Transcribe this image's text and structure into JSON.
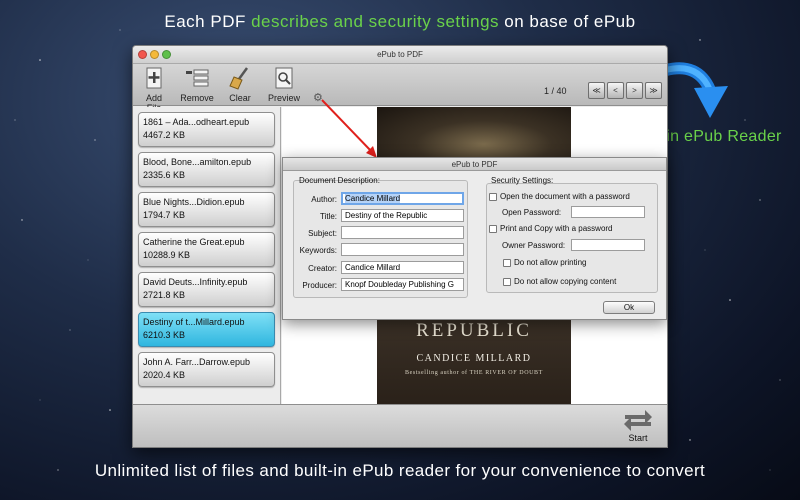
{
  "promo": {
    "headline_part1": "Each PDF ",
    "headline_highlight": "describes and security settings",
    "headline_part2": " on base of ePub",
    "reader_caption": "Built-in ePub Reader",
    "footer": "Unlimited list of files and built-in ePub reader for your convenience  to convert",
    "highlight_color": "#6ad24a"
  },
  "window": {
    "title": "ePub to PDF",
    "toolbar": {
      "add_file": "Add File",
      "remove": "Remove",
      "clear": "Clear",
      "preview": "Preview"
    },
    "page_indicator": "1 / 40",
    "nav": [
      "≪",
      "<",
      ">",
      "≫"
    ],
    "files": [
      {
        "name": "1861 – Ada...odheart.epub",
        "size": "4467.2 KB",
        "selected": false
      },
      {
        "name": "Blood, Bone...amilton.epub",
        "size": "2335.6 KB",
        "selected": false
      },
      {
        "name": "Blue Nights...Didion.epub",
        "size": "1794.7 KB",
        "selected": false
      },
      {
        "name": "Catherine the Great.epub",
        "size": "10288.9 KB",
        "selected": false
      },
      {
        "name": "David Deuts...Infinity.epub",
        "size": "2721.8 KB",
        "selected": false
      },
      {
        "name": "Destiny of t...Millard.epub",
        "size": "6210.3 KB",
        "selected": true
      },
      {
        "name": "John A. Farr...Darrow.epub",
        "size": "2020.4 KB",
        "selected": false
      }
    ],
    "preview": {
      "book_title": "REPUBLIC",
      "book_author": "CANDICE MILLARD",
      "book_tag": "Bestselling author of THE RIVER OF DOUBT"
    },
    "start_label": "Start"
  },
  "dialog": {
    "title": "ePub to PDF",
    "document_description_label": "Document Description:",
    "fields": {
      "author_label": "Author:",
      "author_value": "Candice Millard",
      "title_label": "Title:",
      "title_value": "Destiny of the Republic",
      "subject_label": "Subject:",
      "subject_value": "",
      "keywords_label": "Keywords:",
      "keywords_value": "",
      "creator_label": "Creator:",
      "creator_value": "Candice Millard",
      "producer_label": "Producer:",
      "producer_value": "Knopf Doubleday Publishing G"
    },
    "security": {
      "label": "Security Settings:",
      "open_with_password": "Open the document with a password",
      "open_password_label": "Open Password:",
      "print_copy_password": "Print and Copy with a password",
      "owner_password_label": "Owner Password:",
      "no_printing": "Do not allow printing",
      "no_copying": "Do not allow copying content"
    },
    "ok_label": "Ok"
  }
}
